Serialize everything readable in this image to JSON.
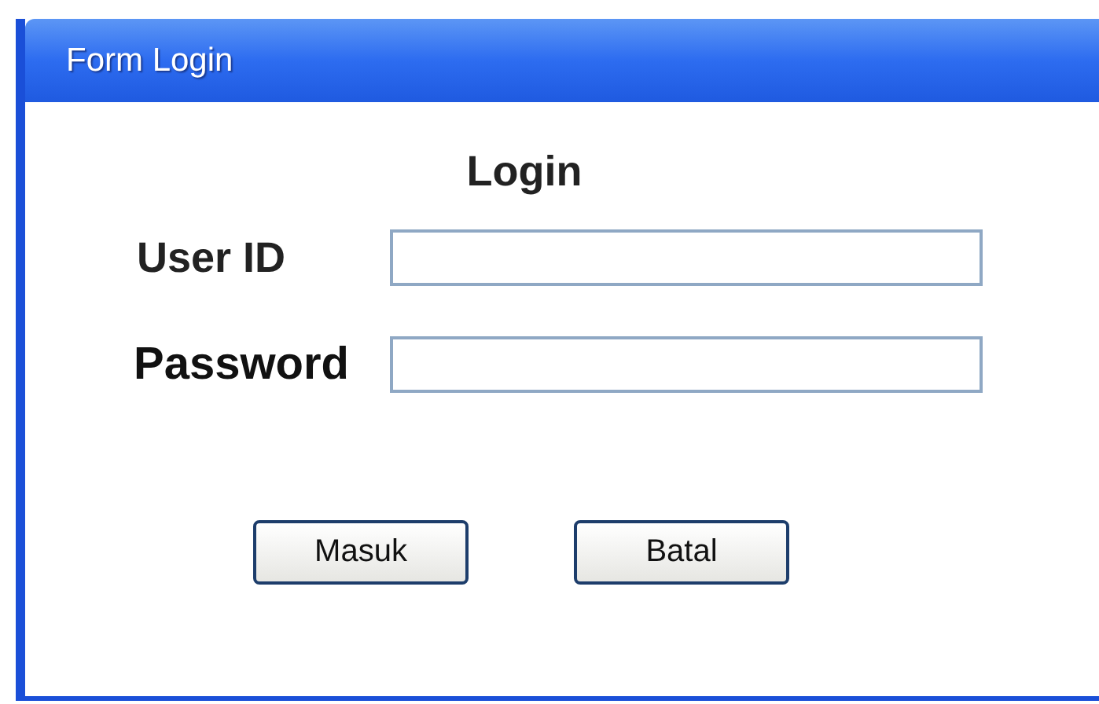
{
  "window": {
    "title": "Form Login"
  },
  "heading": "Login",
  "fields": [
    {
      "label": "User ID"
    },
    {
      "label": "Password"
    }
  ],
  "buttons": [
    "Masuk",
    "Batal"
  ]
}
